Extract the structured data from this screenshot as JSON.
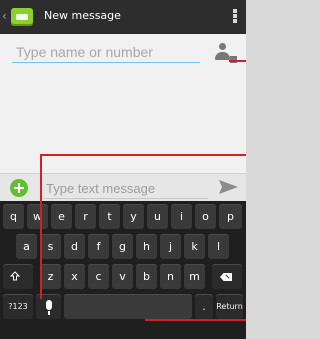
{
  "app": {
    "title": "New message"
  },
  "recipient": {
    "placeholder": "Type name or number"
  },
  "compose": {
    "placeholder": "Type text message"
  },
  "keyboard": {
    "row1": [
      "q",
      "w",
      "e",
      "r",
      "t",
      "y",
      "u",
      "i",
      "o",
      "p"
    ],
    "row2": [
      "a",
      "s",
      "d",
      "f",
      "g",
      "h",
      "j",
      "k",
      "l"
    ],
    "row3": [
      "z",
      "x",
      "c",
      "v",
      "b",
      "n",
      "m"
    ],
    "symbols_label": "?123",
    "period_label": ".",
    "return_label": "Return"
  },
  "icons": {
    "back": "chevron-left-icon",
    "app": "messaging-app-icon",
    "overflow": "overflow-menu-icon",
    "contact": "add-contact-icon",
    "attach": "add-attachment-icon",
    "send": "send-icon",
    "shift": "shift-icon",
    "backspace": "backspace-icon",
    "mic": "microphone-icon"
  },
  "colors": {
    "action_bar": "#2d2d2d",
    "focus_underline": "#69c7f2",
    "attach": "#61bf31",
    "annotation": "#d41f26"
  }
}
